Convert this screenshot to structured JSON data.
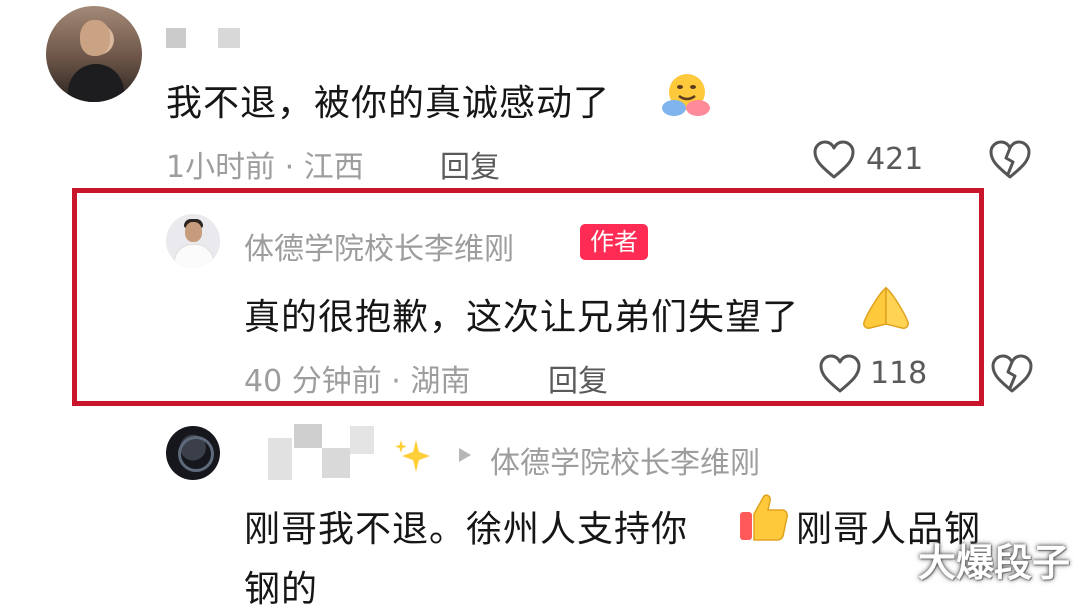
{
  "comments": [
    {
      "text": "我不退，被你的真诚感动了",
      "emoji": "hugging-face",
      "time": "1小时前",
      "location": "江西",
      "reply_label": "回复",
      "likes": "421"
    },
    {
      "author": "体德学院校长李维刚",
      "author_tag": "作者",
      "text": "真的很抱歉，这次让兄弟们失望了",
      "emoji": "folded-hands",
      "time": "40 分钟前",
      "location": "湖南",
      "reply_label": "回复",
      "likes": "118"
    },
    {
      "reply_to": "体德学院校长李维刚",
      "text_line1": "刚哥我不退。徐州人支持你",
      "text_line2": "刚哥人品钢",
      "text_line3": "钢的",
      "emoji": "thumbs-up"
    }
  ],
  "meta_separator": "·",
  "watermark": "大爆段子",
  "icons": {
    "like": "heart-outline-icon",
    "dislike": "broken-heart-icon",
    "reply_arrow": "play-triangle-icon",
    "sparkle": "sparkles-icon"
  },
  "colors": {
    "highlight_border": "#c8152b",
    "author_tag_bg": "#fe2c55",
    "meta_text": "#9d9d9d"
  }
}
